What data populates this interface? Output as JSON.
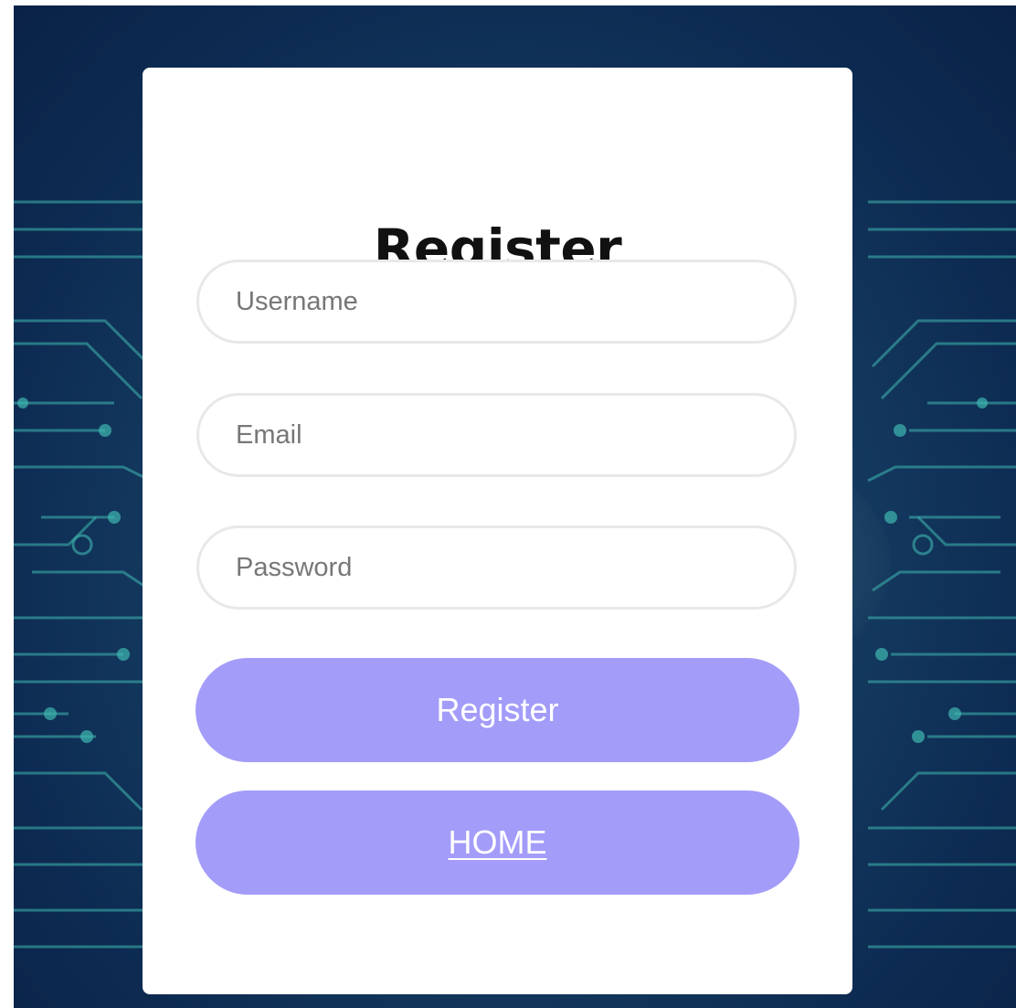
{
  "form": {
    "title": "Register",
    "username_placeholder": "Username",
    "email_placeholder": "Email",
    "password_placeholder": "Password",
    "submit_label": "Register",
    "home_label": "HOME"
  },
  "colors": {
    "button": "#a39cf9",
    "background_dark": "#0d2b52",
    "circuit": "#3fb8b0"
  }
}
